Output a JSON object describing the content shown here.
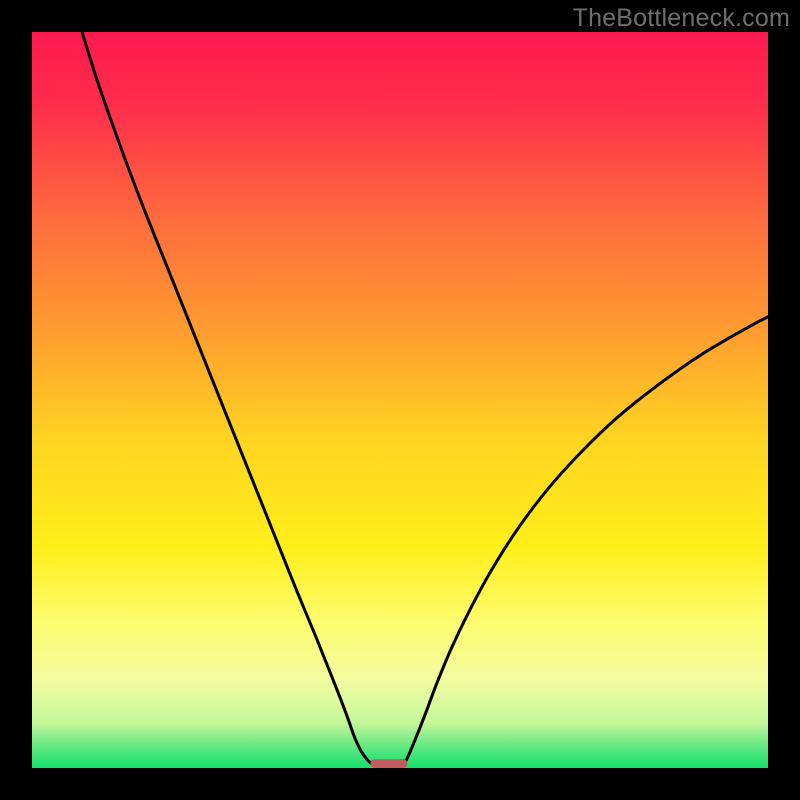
{
  "watermark": "TheBottleneck.com",
  "chart_data": {
    "type": "line",
    "title": "",
    "xlabel": "",
    "ylabel": "",
    "xlim": [
      0,
      100
    ],
    "ylim": [
      0,
      100
    ],
    "grid": false,
    "legend": false,
    "background_gradient_stops": [
      {
        "pos": 0.0,
        "color": "#ff1a4e"
      },
      {
        "pos": 0.1,
        "color": "#ff2d4b"
      },
      {
        "pos": 0.25,
        "color": "#ff6a3e"
      },
      {
        "pos": 0.4,
        "color": "#ff9a30"
      },
      {
        "pos": 0.55,
        "color": "#ffd321"
      },
      {
        "pos": 0.7,
        "color": "#ffef1a"
      },
      {
        "pos": 0.8,
        "color": "#fdfb6d"
      },
      {
        "pos": 0.88,
        "color": "#f3fca0"
      },
      {
        "pos": 0.94,
        "color": "#c3f79a"
      },
      {
        "pos": 0.975,
        "color": "#55e67f"
      },
      {
        "pos": 1.0,
        "color": "#17e36d"
      }
    ],
    "series": [
      {
        "name": "left-branch",
        "x": [
          6.8,
          9,
          12,
          15,
          18,
          21,
          24,
          27,
          30,
          33,
          36,
          38.5,
          40.5,
          42,
          43,
          43.7,
          44.3,
          44.9,
          45.5,
          46.0,
          46.5
        ],
        "y": [
          100,
          93,
          84.5,
          76.5,
          69,
          61.5,
          54,
          46.5,
          39,
          31.5,
          24,
          18,
          13,
          9.2,
          6.5,
          4.5,
          3.1,
          2.0,
          1.2,
          0.7,
          0.4
        ]
      },
      {
        "name": "right-branch",
        "x": [
          50.5,
          51.2,
          52.2,
          53.5,
          55,
          57,
          59.5,
          62.5,
          66,
          70,
          74.5,
          79.5,
          85,
          91,
          97.5,
          100
        ],
        "y": [
          0.4,
          1.8,
          4.2,
          7.5,
          11.5,
          16.3,
          21.5,
          27.0,
          32.5,
          37.8,
          42.8,
          47.6,
          52.0,
          56.2,
          60.0,
          61.3
        ]
      }
    ],
    "marker": {
      "x": 48.5,
      "y": 0.0,
      "width": 5.0,
      "height": 1.2,
      "color": "#c25b5d"
    }
  }
}
